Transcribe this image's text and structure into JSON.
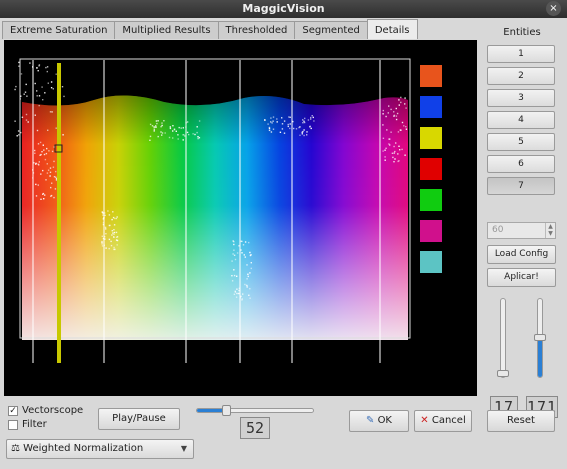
{
  "window": {
    "title": "MaggicVision",
    "close_glyph": "×"
  },
  "tabs": [
    {
      "label": "Extreme Saturation",
      "active": false
    },
    {
      "label": "Multiplied Results",
      "active": false
    },
    {
      "label": "Thresholded",
      "active": false
    },
    {
      "label": "Segmented",
      "active": false
    },
    {
      "label": "Details",
      "active": true
    }
  ],
  "vectorscope": {
    "swatches": [
      "#e8541c",
      "#1040e8",
      "#d8d800",
      "#e00000",
      "#10cc10",
      "#d0108c",
      "#5cc4c4"
    ],
    "spectrum_stops": [
      "#e81c1c",
      "#f05010",
      "#f0a000",
      "#c8d000",
      "#60d000",
      "#00c840",
      "#00c8b0",
      "#00a0e8",
      "#0040e0",
      "#2000d0",
      "#8000d0",
      "#c000b0",
      "#e0007a"
    ]
  },
  "entities": {
    "header": "Entities",
    "buttons": [
      "1",
      "2",
      "3",
      "4",
      "5",
      "6",
      "7"
    ],
    "pressed_index": 6
  },
  "side": {
    "spin_value": "60",
    "load_config": "Load Config",
    "apply": "Aplicar!",
    "slider1_level": 0.02,
    "slider2_level": 0.5,
    "lcd1": "17",
    "lcd2": "171"
  },
  "bottom": {
    "vectorscope_label": "Vectorscope",
    "vectorscope_checked": true,
    "filter_label": "Filter",
    "filter_checked": false,
    "play_pause": "Play/Pause",
    "slider_level": 0.25,
    "lcd": "52",
    "ok": "OK",
    "cancel": "Cancel",
    "reset": "Reset",
    "normalization": "Weighted Normalization",
    "check_glyph": "✓"
  }
}
